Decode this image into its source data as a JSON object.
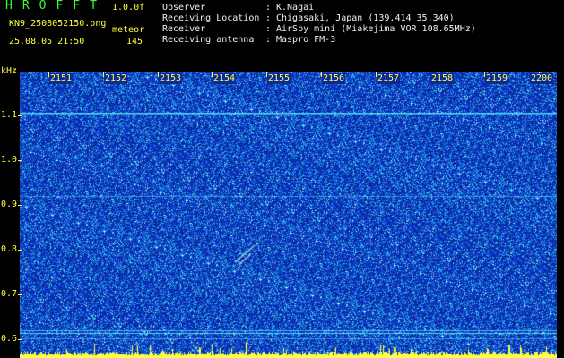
{
  "header": {
    "app_title": "HROFFT",
    "version": "1.0.0f",
    "filename": "KN9_2508052150.png",
    "timestamp": "25.08.05 21:50",
    "meteor_label": "meteor",
    "meteor_count": "145"
  },
  "info": [
    {
      "key": "Observer",
      "value": "K.Nagai"
    },
    {
      "key": "Receiving Location",
      "value": "Chigasaki, Japan (139.414 35.340)"
    },
    {
      "key": "Receiver",
      "value": "AirSpy mini (Miakejima VOR 108.65MHz)"
    },
    {
      "key": "Receiving antenna",
      "value": "Maspro FM-3"
    }
  ],
  "info_separator": ":",
  "axis": {
    "y_unit": "kHz",
    "x_ticks": [
      "2151",
      "2152",
      "2153",
      "2154",
      "2155",
      "2156",
      "2157",
      "2158",
      "2159",
      "2200"
    ],
    "y_ticks": [
      "1.1",
      "1.0",
      "0.9",
      "0.8",
      "0.7",
      "0.6"
    ]
  },
  "colors": {
    "background": "#000000",
    "spectrogram_base": "#0a2a9a",
    "noise_bright": "#3ad6ff",
    "carrier_line": "#5ae8ff",
    "meteor_trace": "#c8ffd8",
    "label_green": "#33ff33",
    "label_yellow": "#ffff44",
    "label_white": "#f0f0f0"
  }
}
